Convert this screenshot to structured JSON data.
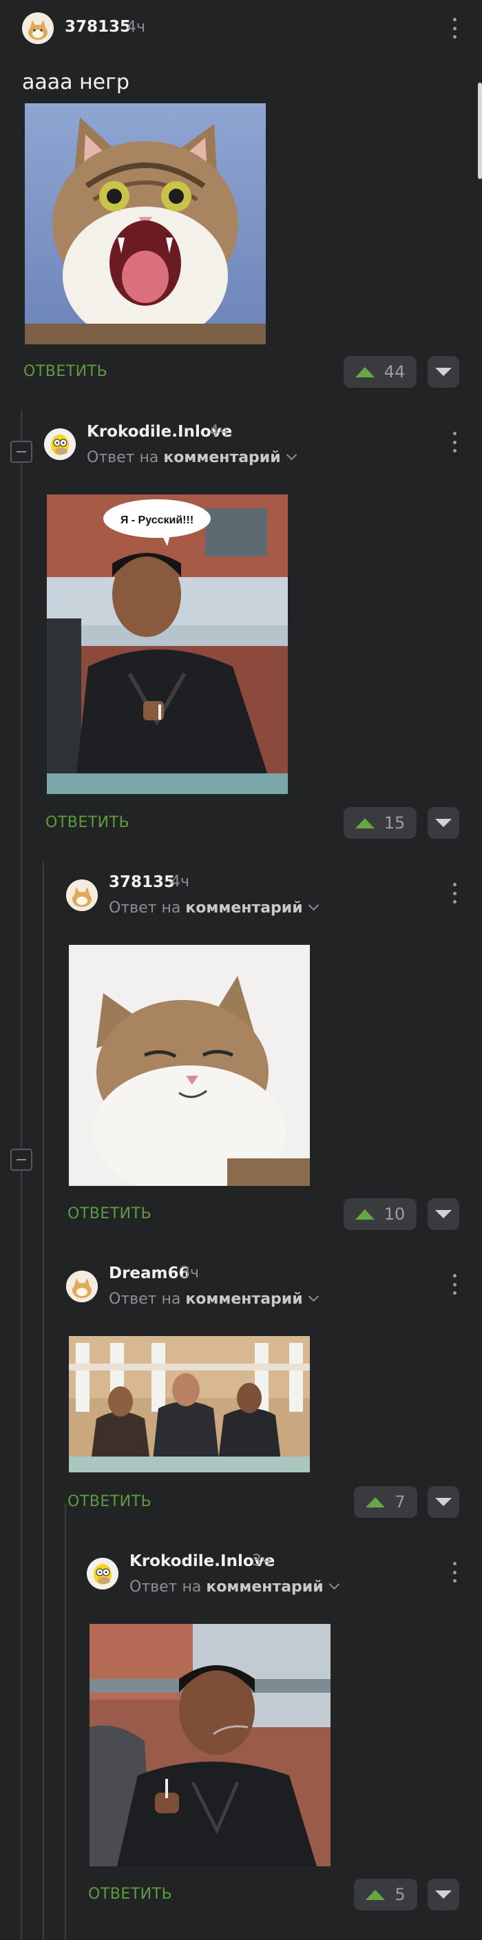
{
  "post": {
    "username": "378135",
    "time": "4ч",
    "text": "аааа негр",
    "reply_label": "ОТВЕТИТЬ",
    "rating": "44",
    "image_icon": "screaming-cat-photo"
  },
  "comments": [
    {
      "username": "Krokodile.Inlove",
      "time": "4ч",
      "reply_to_prefix": "Ответ на",
      "reply_to_link": "комментарий",
      "image_caption": "Я - Русский!!!",
      "reply_label": "ОТВЕТИТЬ",
      "rating": "15",
      "avatar_icon": "homer-simpson-avatar"
    },
    {
      "username": "378135",
      "time": "4ч",
      "reply_to_prefix": "Ответ на",
      "reply_to_link": "комментарий",
      "reply_label": "ОТВЕТИТЬ",
      "rating": "10",
      "avatar_icon": "cat-avatar",
      "image_icon": "smug-cat-photo"
    },
    {
      "username": "Dream66",
      "time": "3ч",
      "reply_to_prefix": "Ответ на",
      "reply_to_link": "комментарий",
      "reply_label": "ОТВЕТИТЬ",
      "rating": "7",
      "avatar_icon": "cat-avatar",
      "image_icon": "three-men-photo"
    },
    {
      "username": "Krokodile.Inlove",
      "time": "3ч",
      "reply_to_prefix": "Ответ на",
      "reply_to_link": "комментарий",
      "reply_label": "ОТВЕТИТЬ",
      "rating": "5",
      "avatar_icon": "homer-simpson-avatar",
      "image_icon": "smoking-man-photo"
    }
  ],
  "colors": {
    "background": "#222325",
    "accent_green": "#5c9c3f",
    "vote_bg": "#3a3b3e"
  }
}
